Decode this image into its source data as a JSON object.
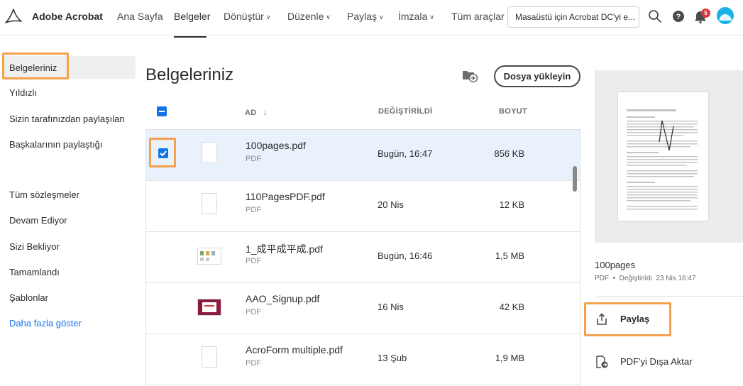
{
  "app": {
    "brand": "Adobe Acrobat"
  },
  "nav": {
    "items": [
      {
        "label": "Ana Sayfa",
        "chevron": false
      },
      {
        "label": "Belgeler",
        "chevron": false,
        "active": true
      },
      {
        "label": "Dönüştür",
        "chevron": true
      },
      {
        "label": "Düzenle",
        "chevron": true
      },
      {
        "label": "Paylaş",
        "chevron": true
      },
      {
        "label": "İmzala",
        "chevron": true
      },
      {
        "label": "Tüm araçlar",
        "chevron": false
      }
    ],
    "desktop_button": "Masaüstü için Acrobat DC'yi e...",
    "notification_count": "5"
  },
  "sidebar": {
    "items": [
      {
        "label": "Belgeleriniz",
        "active": true
      },
      {
        "label": "Yıldızlı"
      },
      {
        "label": "Sizin tarafınızdan paylaşılan"
      },
      {
        "label": "Başkalarının paylaştığı"
      },
      {
        "label": "Tüm sözleşmeler"
      },
      {
        "label": "Devam Ediyor"
      },
      {
        "label": "Sizi Bekliyor"
      },
      {
        "label": "Tamamlandı"
      },
      {
        "label": "Şablonlar"
      }
    ],
    "more_link": "Daha fazla göster"
  },
  "main": {
    "title": "Belgeleriniz",
    "upload_label": "Dosya yükleyin",
    "columns": {
      "name": "AD",
      "name_sort": "↓",
      "modified": "DEĞİŞTİRİLDİ",
      "size": "BOYUT"
    },
    "files": [
      {
        "name": "100pages.pdf",
        "type": "PDF",
        "modified": "Bugün, 16:47",
        "size": "856 KB",
        "selected": true
      },
      {
        "name": "110PagesPDF.pdf",
        "type": "PDF",
        "modified": "20 Nis",
        "size": "12 KB"
      },
      {
        "name": "1_成平成平成.pdf",
        "type": "PDF",
        "modified": "Bugün, 16:46",
        "size": "1,5 MB"
      },
      {
        "name": "AAO_Signup.pdf",
        "type": "PDF",
        "modified": "16 Nis",
        "size": "42 KB"
      },
      {
        "name": "AcroForm multiple.pdf",
        "type": "PDF",
        "modified": "13 Şub",
        "size": "1,9 MB"
      }
    ]
  },
  "details": {
    "title": "100pages",
    "type": "PDF",
    "bullet": "•",
    "modified_label": "Değiştirildi",
    "modified_value": "23 Nis 16:47",
    "actions": [
      {
        "label": "Paylaş",
        "icon": "share-icon"
      },
      {
        "label": "PDF'yi Dışa Aktar",
        "icon": "export-pdf-icon"
      }
    ]
  },
  "colors": {
    "accent": "#1473e6",
    "highlight": "#f5a04c",
    "selected_row": "#e9f2fc",
    "badge": "#d7373f"
  }
}
